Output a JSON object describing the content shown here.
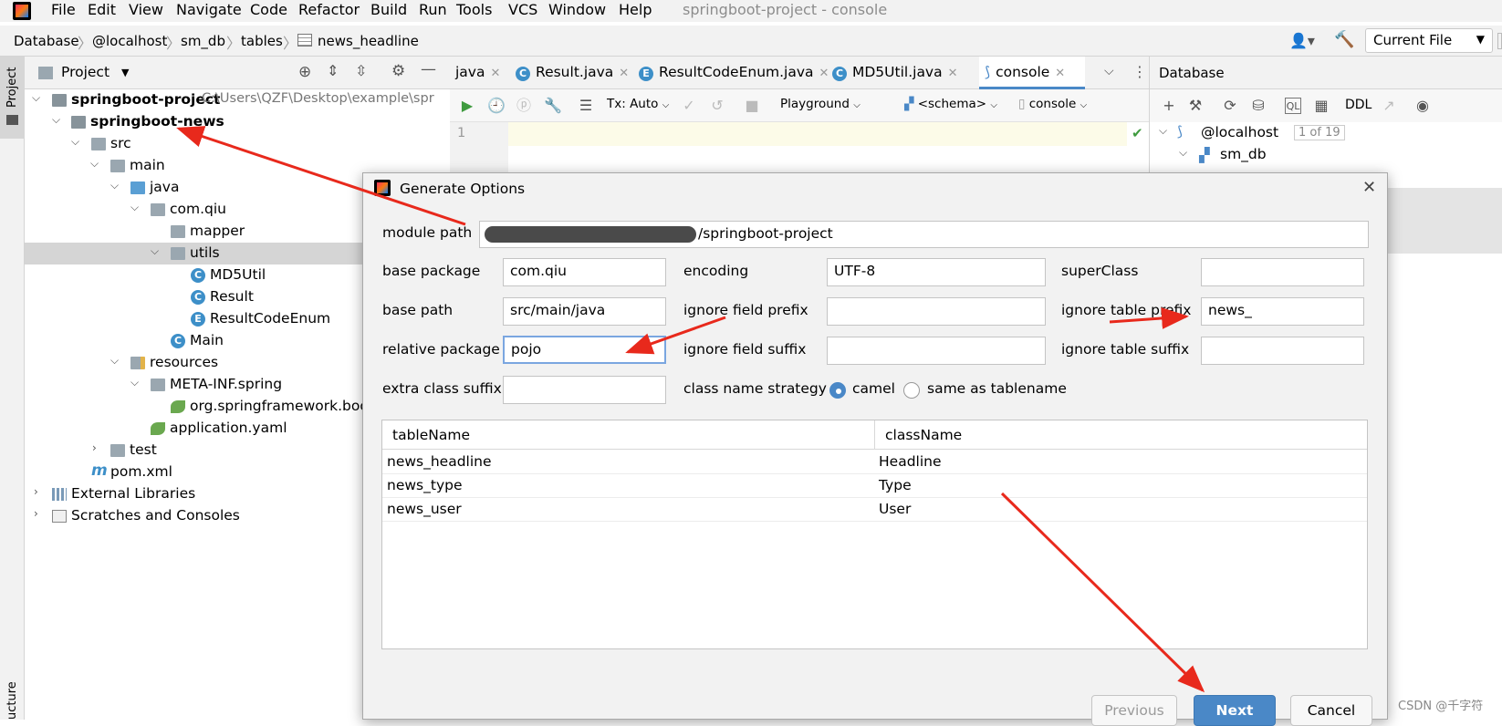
{
  "menubar": {
    "items": [
      "File",
      "Edit",
      "View",
      "Navigate",
      "Code",
      "Refactor",
      "Build",
      "Run",
      "Tools",
      "VCS",
      "Window",
      "Help"
    ],
    "window_title": "springboot-project - console"
  },
  "navbar": {
    "breadcrumbs": [
      "Database",
      "@localhost",
      "sm_db",
      "tables",
      "news_headline"
    ],
    "run_config": "Current File"
  },
  "left_strip": {
    "project_label": "Project",
    "structure_label": "ucture"
  },
  "project_panel": {
    "title": "Project",
    "tree": [
      {
        "label": "springboot-project",
        "hint": "C:\\Users\\QZF\\Desktop\\example\\spr",
        "bold": true
      },
      {
        "label": "springboot-news",
        "bold": true
      },
      {
        "label": "src"
      },
      {
        "label": "main"
      },
      {
        "label": "java"
      },
      {
        "label": "com.qiu"
      },
      {
        "label": "mapper"
      },
      {
        "label": "utils"
      },
      {
        "label": "MD5Util"
      },
      {
        "label": "Result"
      },
      {
        "label": "ResultCodeEnum"
      },
      {
        "label": "Main"
      },
      {
        "label": "resources"
      },
      {
        "label": "META-INF.spring"
      },
      {
        "label": "org.springframework.boo"
      },
      {
        "label": "application.yaml"
      },
      {
        "label": "test"
      },
      {
        "label": "pom.xml"
      },
      {
        "label": "External Libraries"
      },
      {
        "label": "Scratches and Consoles"
      }
    ]
  },
  "editor": {
    "tabs": [
      {
        "label": "java"
      },
      {
        "label": "Result.java"
      },
      {
        "label": "ResultCodeEnum.java"
      },
      {
        "label": "MD5Util.java"
      },
      {
        "label": "console"
      }
    ],
    "toolbar": {
      "tx_mode": "Tx: Auto",
      "playground": "Playground",
      "schema": "<schema>",
      "session": "console"
    },
    "line_number": "1"
  },
  "database_panel": {
    "title": "Database",
    "ddl_label": "DDL",
    "tree": [
      {
        "label": "@localhost",
        "badge": "1 of 19"
      },
      {
        "label": "sm_db"
      }
    ]
  },
  "dialog": {
    "title": "Generate Options",
    "module_path_label": "module path",
    "module_path_value": "/springboot-project",
    "fields": {
      "base_package": {
        "label": "base package",
        "value": "com.qiu"
      },
      "encoding": {
        "label": "encoding",
        "value": "UTF-8"
      },
      "super_class": {
        "label": "superClass",
        "value": ""
      },
      "base_path": {
        "label": "base path",
        "value": "src/main/java"
      },
      "ignore_field_prefix": {
        "label": "ignore field prefix",
        "value": ""
      },
      "ignore_table_prefix": {
        "label": "ignore table prefix",
        "value": "news_"
      },
      "relative_package": {
        "label": "relative package",
        "value": "pojo"
      },
      "ignore_field_suffix": {
        "label": "ignore field suffix",
        "value": ""
      },
      "ignore_table_suffix": {
        "label": "ignore table suffix",
        "value": ""
      },
      "extra_class_suffix": {
        "label": "extra class suffix",
        "value": ""
      }
    },
    "class_name_strategy": {
      "label": "class name strategy",
      "options": [
        "camel",
        "same as tablename"
      ],
      "selected": "camel"
    },
    "table": {
      "columns": [
        "tableName",
        "className"
      ],
      "rows": [
        [
          "news_headline",
          "Headline"
        ],
        [
          "news_type",
          "Type"
        ],
        [
          "news_user",
          "User"
        ]
      ]
    },
    "buttons": {
      "previous": "Previous",
      "next": "Next",
      "cancel": "Cancel"
    }
  },
  "annotation_color": "#e8291c",
  "watermark": "CSDN @千字符"
}
